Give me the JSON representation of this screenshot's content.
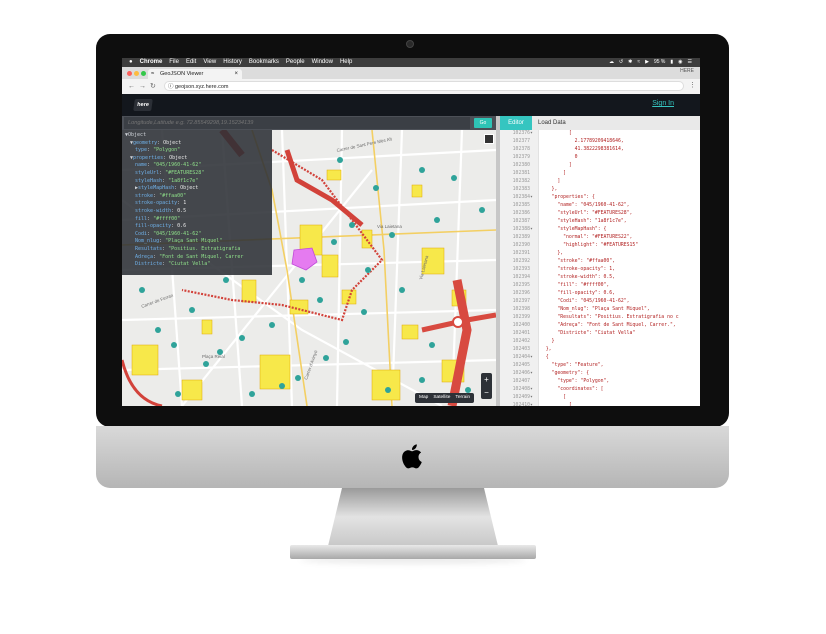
{
  "menubar": {
    "apple": "",
    "app": "Chrome",
    "items": [
      "File",
      "Edit",
      "View",
      "History",
      "Bookmarks",
      "People",
      "Window",
      "Help"
    ],
    "battery": "95 %",
    "right_icons": [
      "creative-cloud-icon",
      "time-machine-icon",
      "bluetooth-icon",
      "wifi-icon",
      "airplay-icon",
      "volume-icon",
      "battery-icon",
      "siri-icon",
      "user-icon",
      "menu-list-icon"
    ]
  },
  "browser": {
    "tab_title": "GeoJSON Viewer",
    "corner_label": "HERE",
    "url": "geojson.xyz.here.com"
  },
  "app": {
    "logo": "here",
    "sign_in": "Sign In"
  },
  "search": {
    "placeholder": "Longitude,Latitude e.g. 72.85549298,19.15234139",
    "go": "Go"
  },
  "inspector": {
    "root": "Object",
    "lines": [
      {
        "indent": 1,
        "key": "geometry",
        "val": "Object",
        "type": "obj",
        "arrow": "▼"
      },
      {
        "indent": 2,
        "key": "type",
        "val": "\"Polygon\"",
        "type": "str"
      },
      {
        "indent": 1,
        "key": "properties",
        "val": "Object",
        "type": "obj",
        "arrow": "▼"
      },
      {
        "indent": 2,
        "key": "name",
        "val": "\"045/1960-41-62\"",
        "type": "str"
      },
      {
        "indent": 2,
        "key": "styleUrl",
        "val": "\"#FEATURES28\"",
        "type": "str"
      },
      {
        "indent": 2,
        "key": "styleHash",
        "val": "\"1a8f1c7e\"",
        "type": "str"
      },
      {
        "indent": 2,
        "key": "styleMapHash",
        "val": "Object",
        "type": "obj",
        "arrow": "▶"
      },
      {
        "indent": 2,
        "key": "stroke",
        "val": "\"#ffaa00\"",
        "type": "str"
      },
      {
        "indent": 2,
        "key": "stroke-opacity",
        "val": "1",
        "type": "num"
      },
      {
        "indent": 2,
        "key": "stroke-width",
        "val": "0.5",
        "type": "num"
      },
      {
        "indent": 2,
        "key": "fill",
        "val": "\"#ffff00\"",
        "type": "str"
      },
      {
        "indent": 2,
        "key": "fill-opacity",
        "val": "0.6",
        "type": "num"
      },
      {
        "indent": 2,
        "key": "Codi",
        "val": "\"045/1960-41-62\"",
        "type": "str"
      },
      {
        "indent": 2,
        "key": "Nom_nlug",
        "val": "\"Plaça Sant Miquel\"",
        "type": "str"
      },
      {
        "indent": 2,
        "key": "Resultats",
        "val": "\"Positius. Estratigrafia",
        "type": "str"
      },
      {
        "indent": 2,
        "key": "Adreça",
        "val": "\"Font de Sant Miquel, Carrer",
        "type": "str"
      },
      {
        "indent": 2,
        "key": "Districte",
        "val": "\"Ciutat Vella\"",
        "type": "str"
      }
    ]
  },
  "map": {
    "type_buttons": [
      "Map",
      "Satellite",
      "Terrain"
    ],
    "zoom_in": "+",
    "zoom_out": "−",
    "labels": [
      "Carrer de Sant Pere Més Alt",
      "Via Laietana",
      "Carrer de Ferran",
      "Carrer d'Avinyó",
      "Plaça Reial",
      "Via Laietana"
    ]
  },
  "editor": {
    "tabs": [
      "Editor",
      "Load Data"
    ],
    "lines": [
      {
        "n": "102376",
        "fold": true,
        "code": "          ["
      },
      {
        "n": "102377",
        "code": "            2.17789209418646,"
      },
      {
        "n": "102378",
        "code": "            41.3822298381614,"
      },
      {
        "n": "102379",
        "code": "            0"
      },
      {
        "n": "102380",
        "code": "          ]"
      },
      {
        "n": "102381",
        "code": "        ]"
      },
      {
        "n": "102382",
        "code": "      ]"
      },
      {
        "n": "102383",
        "code": "    },"
      },
      {
        "n": "102384",
        "fold": true,
        "code": "    \"properties\": {"
      },
      {
        "n": "102385",
        "code": "      \"name\": \"045/1960-41-62\","
      },
      {
        "n": "102386",
        "code": "      \"styleUrl\": \"#FEATURES28\","
      },
      {
        "n": "102387",
        "code": "      \"styleHash\": \"1a8f1c7e\","
      },
      {
        "n": "102388",
        "fold": true,
        "code": "      \"styleMapHash\": {"
      },
      {
        "n": "102389",
        "code": "        \"normal\": \"#FEATURES22\","
      },
      {
        "n": "102390",
        "code": "        \"highlight\": \"#FEATURES15\""
      },
      {
        "n": "102391",
        "code": "      },"
      },
      {
        "n": "102392",
        "code": "      \"stroke\": \"#ffaa00\","
      },
      {
        "n": "102393",
        "code": "      \"stroke-opacity\": 1,"
      },
      {
        "n": "102394",
        "code": "      \"stroke-width\": 0.5,"
      },
      {
        "n": "102395",
        "code": "      \"fill\": \"#ffff00\","
      },
      {
        "n": "102396",
        "code": "      \"fill-opacity\": 0.6,"
      },
      {
        "n": "102397",
        "code": "      \"Codi\": \"045/1960-41-62\","
      },
      {
        "n": "102398",
        "code": "      \"Nom_nlug\": \"Plaça Sant Miquel\","
      },
      {
        "n": "102399",
        "code": "      \"Resultats\": \"Positius. Estratigrafia no c"
      },
      {
        "n": "102400",
        "code": "      \"Adreça\": \"Font de Sant Miquel, Carrer.\","
      },
      {
        "n": "102401",
        "code": "      \"Districte\": \"Ciutat Vella\""
      },
      {
        "n": "102402",
        "code": "    }"
      },
      {
        "n": "102403",
        "code": "  },"
      },
      {
        "n": "102404",
        "fold": true,
        "code": "  {"
      },
      {
        "n": "102405",
        "code": "    \"type\": \"Feature\","
      },
      {
        "n": "102406",
        "fold": true,
        "code": "    \"geometry\": {"
      },
      {
        "n": "102407",
        "code": "      \"type\": \"Polygon\","
      },
      {
        "n": "102408",
        "fold": true,
        "code": "      \"coordinates\": ["
      },
      {
        "n": "102409",
        "fold": true,
        "code": "        ["
      },
      {
        "n": "102410",
        "fold": true,
        "code": "          ["
      }
    ]
  },
  "colors": {
    "accent": "#35c5c0",
    "header": "#13171d",
    "route": "#e2453c",
    "polygon": "#f7e84a",
    "point": "#2fa39a",
    "highlight": "#e57bf0"
  }
}
